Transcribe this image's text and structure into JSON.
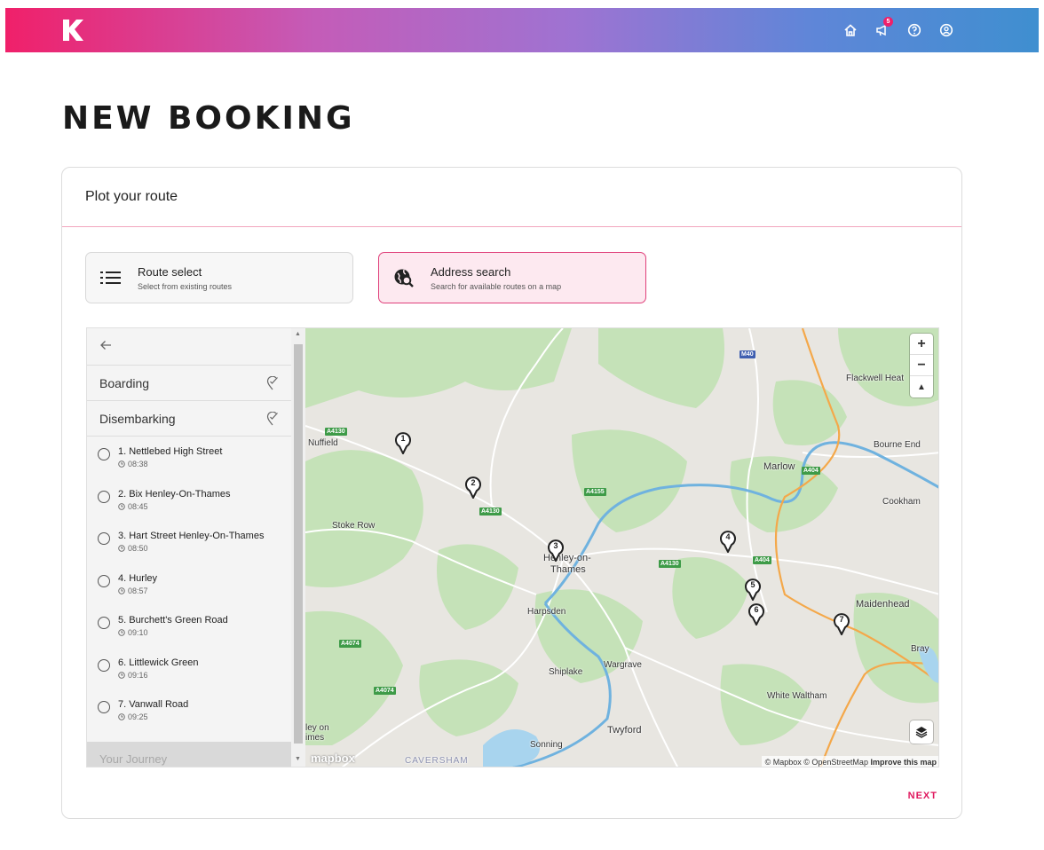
{
  "header": {
    "logo_icon": "k-logo-icon",
    "icons": [
      "home-icon",
      "megaphone-icon",
      "help-icon",
      "account-icon"
    ],
    "notification_count": "5",
    "gradient_colors": [
      "#f0206a",
      "#c45cb8",
      "#9e73d2",
      "#5f86d8",
      "#3f8fd0"
    ]
  },
  "page": {
    "title": "NEW BOOKING"
  },
  "card": {
    "title": "Plot your route",
    "options": [
      {
        "title": "Route select",
        "subtitle": "Select from existing routes",
        "icon": "list-icon",
        "active": false
      },
      {
        "title": "Address search",
        "subtitle": "Search for available routes on a map",
        "icon": "globe-search-icon",
        "active": true
      }
    ],
    "next_label": "NEXT"
  },
  "panel": {
    "back_icon": "arrow-left-icon",
    "boarding_label": "Boarding",
    "disembarking_label": "Disembarking",
    "stops": [
      {
        "name": "1. Nettlebed High Street",
        "time": "08:38"
      },
      {
        "name": "2. Bix Henley-On-Thames",
        "time": "08:45"
      },
      {
        "name": "3. Hart Street Henley-On-Thames",
        "time": "08:50"
      },
      {
        "name": "4. Hurley",
        "time": "08:57"
      },
      {
        "name": "5. Burchett's Green Road",
        "time": "09:10"
      },
      {
        "name": "6. Littlewick Green",
        "time": "09:16"
      },
      {
        "name": "7. Vanwall Road",
        "time": "09:25"
      }
    ],
    "journey_label": "Your Journey"
  },
  "map": {
    "towns": [
      "Nuffield",
      "Stoke Row",
      "Henley-on-",
      "Thames",
      "Harpsden",
      "Shiplake",
      "Wargrave",
      "Twyford",
      "Sonning",
      "CAVERSHAM",
      "Marlow",
      "Bourne End",
      "Flackwell Heat",
      "Cookham",
      "Maidenhead",
      "Bray",
      "White Waltham",
      "ley on",
      "imes"
    ],
    "roads": [
      "M40",
      "A4130",
      "A4130",
      "A4155",
      "A4130",
      "A404",
      "A404",
      "A4074",
      "A4074"
    ],
    "pins": [
      "1",
      "2",
      "3",
      "4",
      "5",
      "6",
      "7"
    ],
    "zoom_in": "+",
    "zoom_out": "−",
    "compass": "▲",
    "attribution": "© Mapbox © OpenStreetMap",
    "improve": "Improve this map",
    "logo_text": "mapbox"
  }
}
